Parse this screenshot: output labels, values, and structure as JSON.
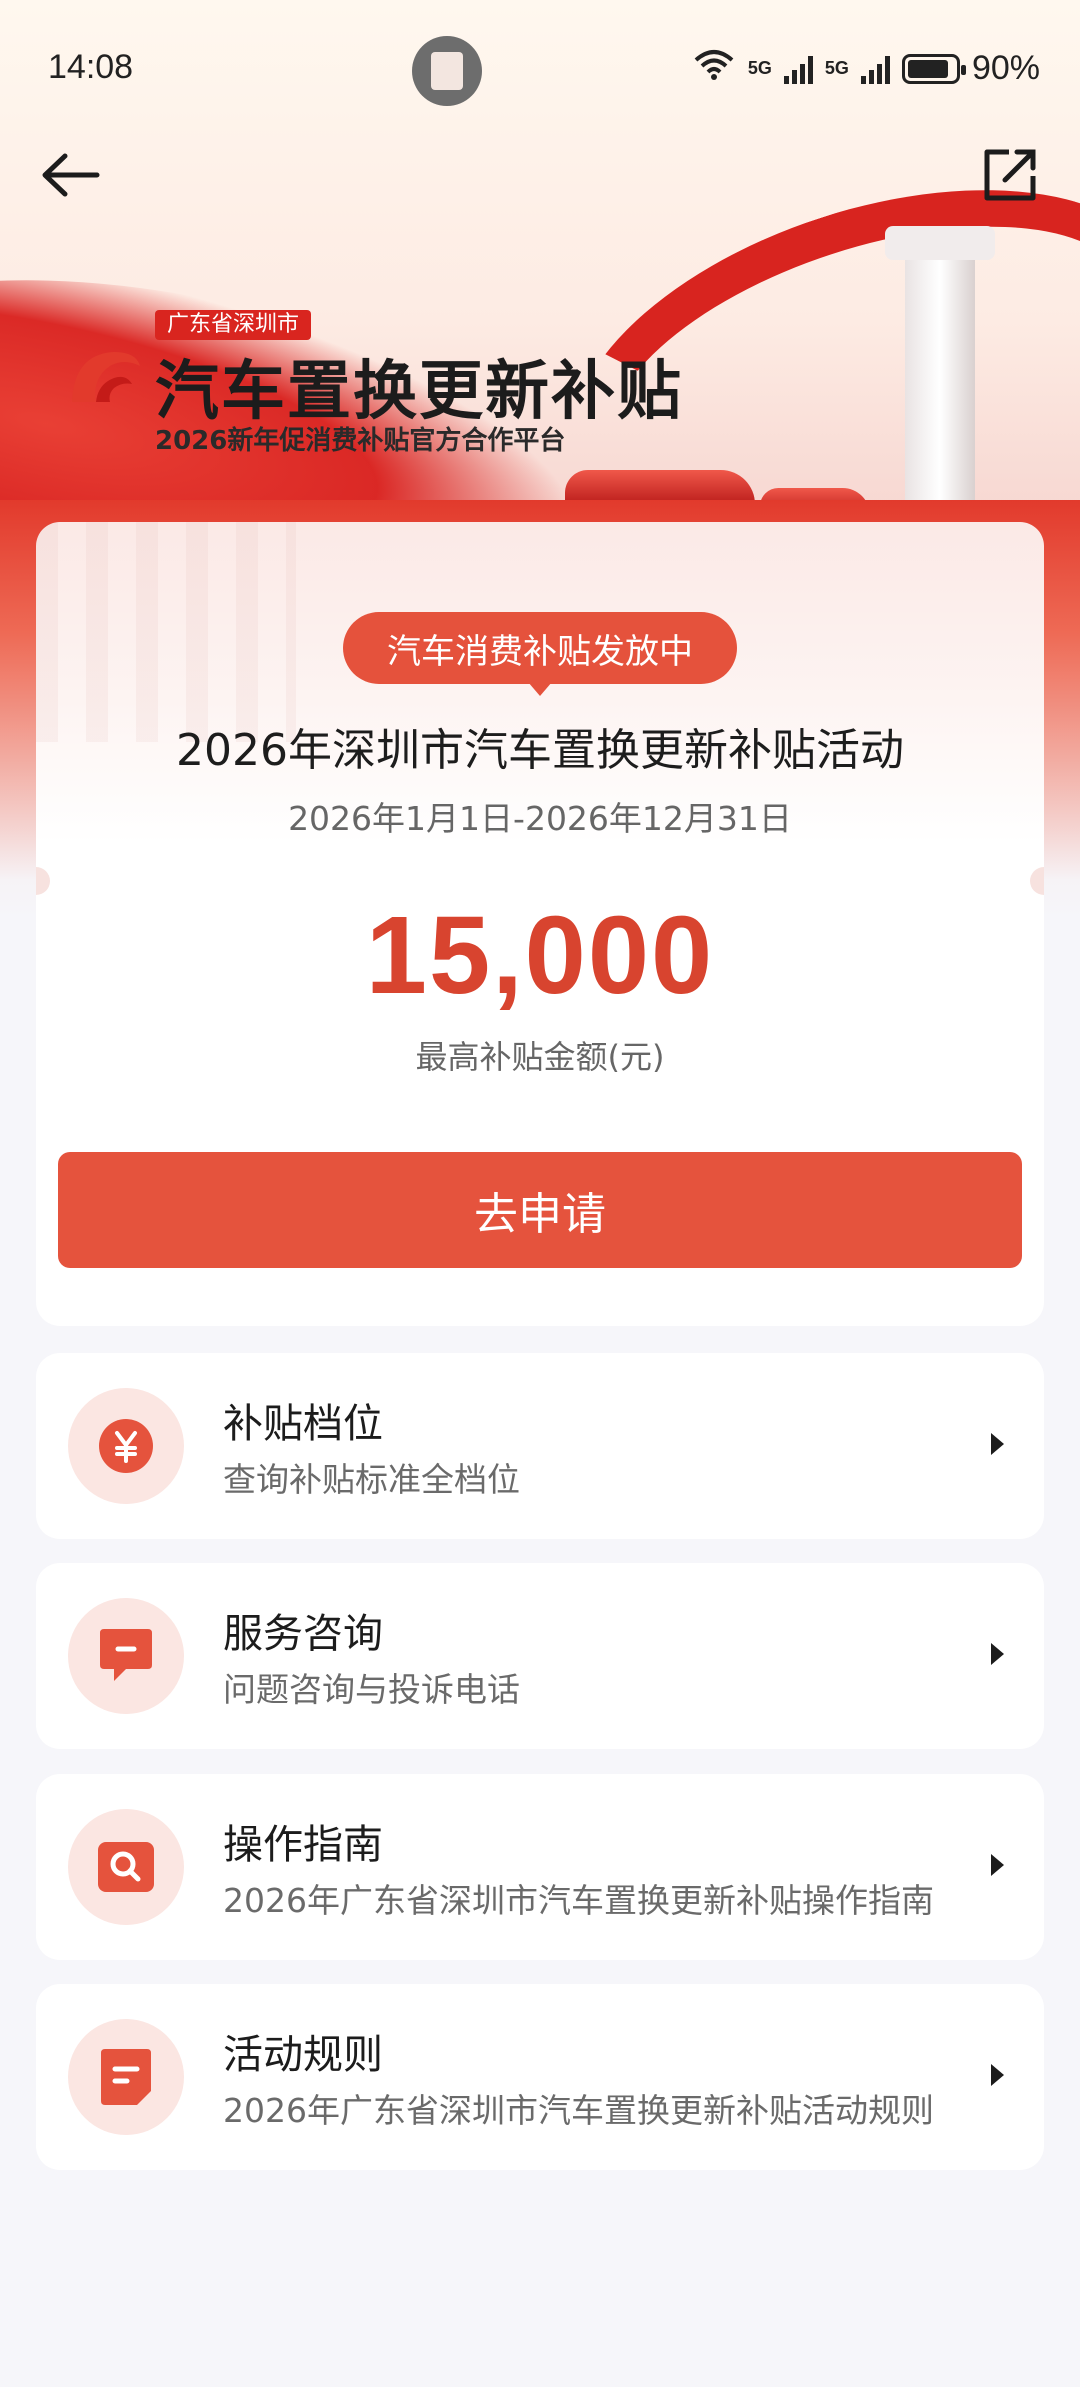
{
  "status_bar": {
    "time": "14:08",
    "signal_1": "6",
    "signal_2": "5G",
    "signal_3": "5G",
    "battery": "90%"
  },
  "banner": {
    "city": "广东省深圳市",
    "title": "汽车置换更新补贴",
    "subtitle": "2026新年促消费补贴官方合作平台"
  },
  "main": {
    "badge": "汽车消费补贴发放中",
    "title": "2026年深圳市汽车置换更新补贴活动",
    "dates": "2026年1月1日-2026年12月31日",
    "amount": "15,000",
    "amount_label": "最高补贴金额(元)",
    "apply_label": "去申请"
  },
  "list": [
    {
      "title": "补贴档位",
      "subtitle": "查询补贴标准全档位",
      "icon": "yuan-icon"
    },
    {
      "title": "服务咨询",
      "subtitle": "问题咨询与投诉电话",
      "icon": "chat-icon"
    },
    {
      "title": "操作指南",
      "subtitle": "2026年广东省深圳市汽车置换更新补贴操作指南",
      "icon": "search-icon"
    },
    {
      "title": "活动规则",
      "subtitle": "2026年广东省深圳市汽车置换更新补贴活动规则",
      "icon": "document-icon"
    }
  ],
  "colors": {
    "accent": "#e5533d",
    "amount": "#d8442f",
    "banner_red": "#d9251f"
  }
}
